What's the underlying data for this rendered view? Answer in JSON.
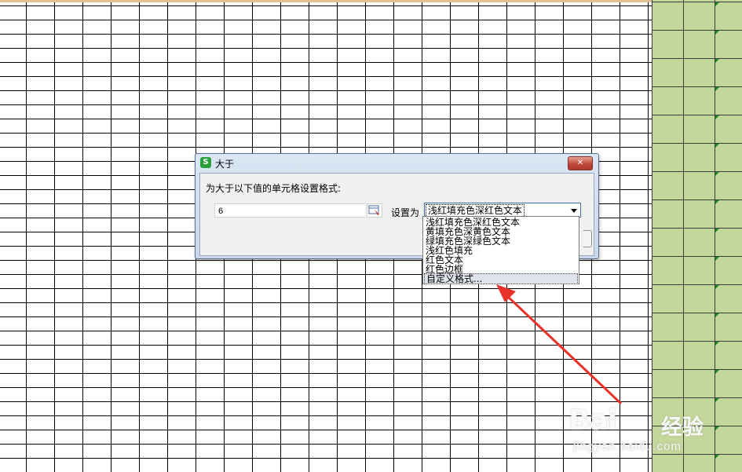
{
  "dialog": {
    "app_icon_glyph": "S",
    "title": "大于",
    "close_glyph": "✕",
    "prompt": "为大于以下值的单元格设置格式:",
    "value": "6",
    "set_as_label": "设置为",
    "selected_format": "浅红填充色深红色文本"
  },
  "dropdown": {
    "items": [
      "浅红填充色深红色文本",
      "黄填充色深黄色文本",
      "绿填充色深绿色文本",
      "浅红色填充",
      "红色文本",
      "红色边框",
      "自定义格式..."
    ],
    "highlighted_index": 6
  },
  "watermark": {
    "logo": "Bai",
    "cn": "经验",
    "url": "jingyan.baidu.com"
  },
  "colors": {
    "annotation_arrow": "#e8322a",
    "sheet_green": "#c4d79b",
    "dialog_frame": "#dbe6f4"
  },
  "icons": [
    "app-logo-icon",
    "close-icon",
    "range-picker-icon",
    "dropdown-arrow-icon",
    "annotation-arrow-icon"
  ]
}
